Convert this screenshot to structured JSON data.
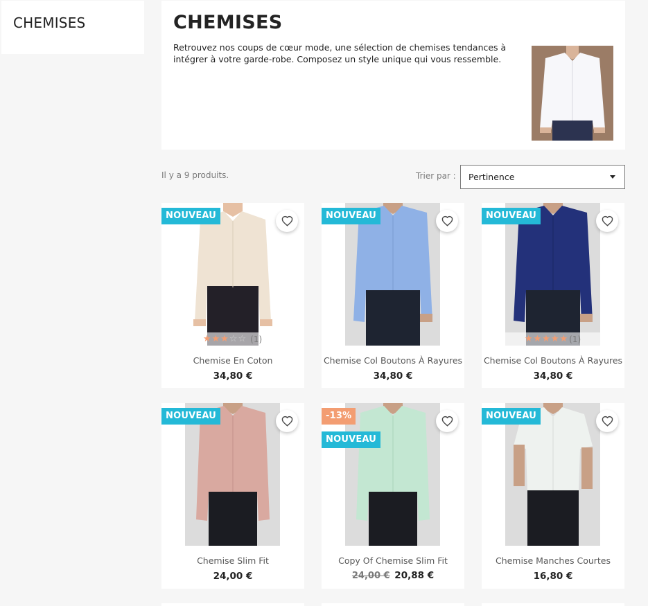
{
  "sidebar": {
    "title": "CHEMISES"
  },
  "header": {
    "title": "CHEMISES",
    "description": "Retrouvez nos coups de cœur mode, une sélection de chemises tendances à intégrer à votre garde-robe. Composez un style unique qui vous ressemble."
  },
  "toolbar": {
    "product_count": "Il y a 9 produits.",
    "sort_label": "Trier par :",
    "sort_value": "Pertinence"
  },
  "colors": {
    "new_badge": "#24b9d7",
    "discount_badge": "#f39d72"
  },
  "products": [
    {
      "name": "Chemise En Coton",
      "price": "34,80 €",
      "badge": "NOUVEAU",
      "rating_count": "(1)",
      "rating_stars": 3,
      "shirt_color": "#efe3d3"
    },
    {
      "name": "Chemise Col Boutons À Rayures",
      "price": "34,80 €",
      "badge": "NOUVEAU",
      "shirt_color": "#8fb1e6"
    },
    {
      "name": "Chemise Col Boutons À Rayures",
      "price": "34,80 €",
      "badge": "NOUVEAU",
      "rating_count": "(1)",
      "rating_stars": 5,
      "shirt_color": "#23317a"
    },
    {
      "name": "Chemise Slim Fit",
      "price": "24,00 €",
      "badge": "NOUVEAU",
      "shirt_color": "#d9a9a0"
    },
    {
      "name": "Copy Of Chemise Slim Fit",
      "old_price": "24,00 €",
      "price": "20,88 €",
      "discount": "-13%",
      "badge": "NOUVEAU",
      "shirt_color": "#c3e7d2"
    },
    {
      "name": "Chemise Manches Courtes",
      "price": "16,80 €",
      "badge": "NOUVEAU",
      "shirt_color": "#eef2ef"
    }
  ]
}
